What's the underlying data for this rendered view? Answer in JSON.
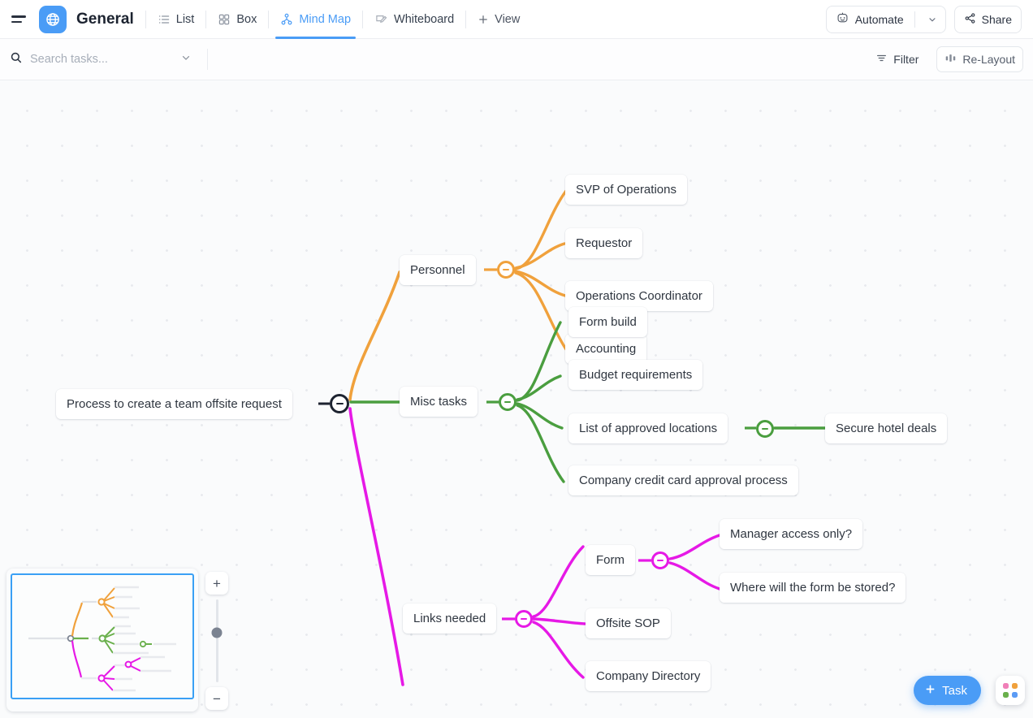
{
  "header": {
    "menu_icon": "hamburger-icon",
    "logo_icon": "globe-icon",
    "space_title": "General",
    "tabs": [
      {
        "label": "List",
        "icon": "list-icon",
        "active": false
      },
      {
        "label": "Box",
        "icon": "box-grid-icon",
        "active": false
      },
      {
        "label": "Mind Map",
        "icon": "mind-map-icon",
        "active": true
      },
      {
        "label": "Whiteboard",
        "icon": "whiteboard-icon",
        "active": false
      }
    ],
    "add_view_label": "View",
    "add_view_icon": "plus-icon",
    "automate_label": "Automate",
    "automate_icon": "robot-icon",
    "automate_chevron_icon": "chevron-down-icon",
    "share_label": "Share",
    "share_icon": "share-icon"
  },
  "toolbar": {
    "search_placeholder": "Search tasks...",
    "search_value": "",
    "search_icon": "search-icon",
    "search_chevron_icon": "chevron-down-icon",
    "filter_label": "Filter",
    "filter_icon": "filter-icon",
    "relayout_label": "Re-Layout",
    "relayout_icon": "bar-chart-icon"
  },
  "colors": {
    "accent": "#4a9cf6",
    "root": "#1d2330",
    "branch_personnel": "#f0a13c",
    "branch_misc": "#4a9e3f",
    "branch_links": "#e619e6",
    "canvas_bg": "#fafbfc"
  },
  "mindmap": {
    "root": {
      "label": "Process to create a team offsite request"
    },
    "branches": [
      {
        "label": "Personnel",
        "color": "#f0a13c",
        "color_name": "orange",
        "children": [
          {
            "label": "SVP of Operations"
          },
          {
            "label": "Requestor"
          },
          {
            "label": "Operations Coordinator"
          },
          {
            "label": "Accounting"
          }
        ]
      },
      {
        "label": "Misc tasks",
        "color": "#4a9e3f",
        "color_name": "green",
        "children": [
          {
            "label": "Form build"
          },
          {
            "label": "Budget requirements"
          },
          {
            "label": "List of approved locations",
            "children": [
              {
                "label": "Secure hotel deals"
              }
            ]
          },
          {
            "label": "Company credit card approval process"
          }
        ]
      },
      {
        "label": "Links needed",
        "color": "#e619e6",
        "color_name": "magenta",
        "children": [
          {
            "label": "Form",
            "children": [
              {
                "label": "Manager access only?"
              },
              {
                "label": "Where will the form be stored?"
              }
            ]
          },
          {
            "label": "Offsite SOP"
          },
          {
            "label": "Company Directory"
          }
        ]
      }
    ]
  },
  "minimap": {
    "name": "minimap-panel"
  },
  "zoom_control": {
    "zoom_in_label": "+",
    "zoom_out_label": "−"
  },
  "fab": {
    "task_label": "Task",
    "task_icon": "plus-icon",
    "grid_icon": "apps-grid-icon",
    "grid_colors": [
      "#f07fb8",
      "#f0a13c",
      "#6ab04c",
      "#5b9bf5"
    ]
  }
}
